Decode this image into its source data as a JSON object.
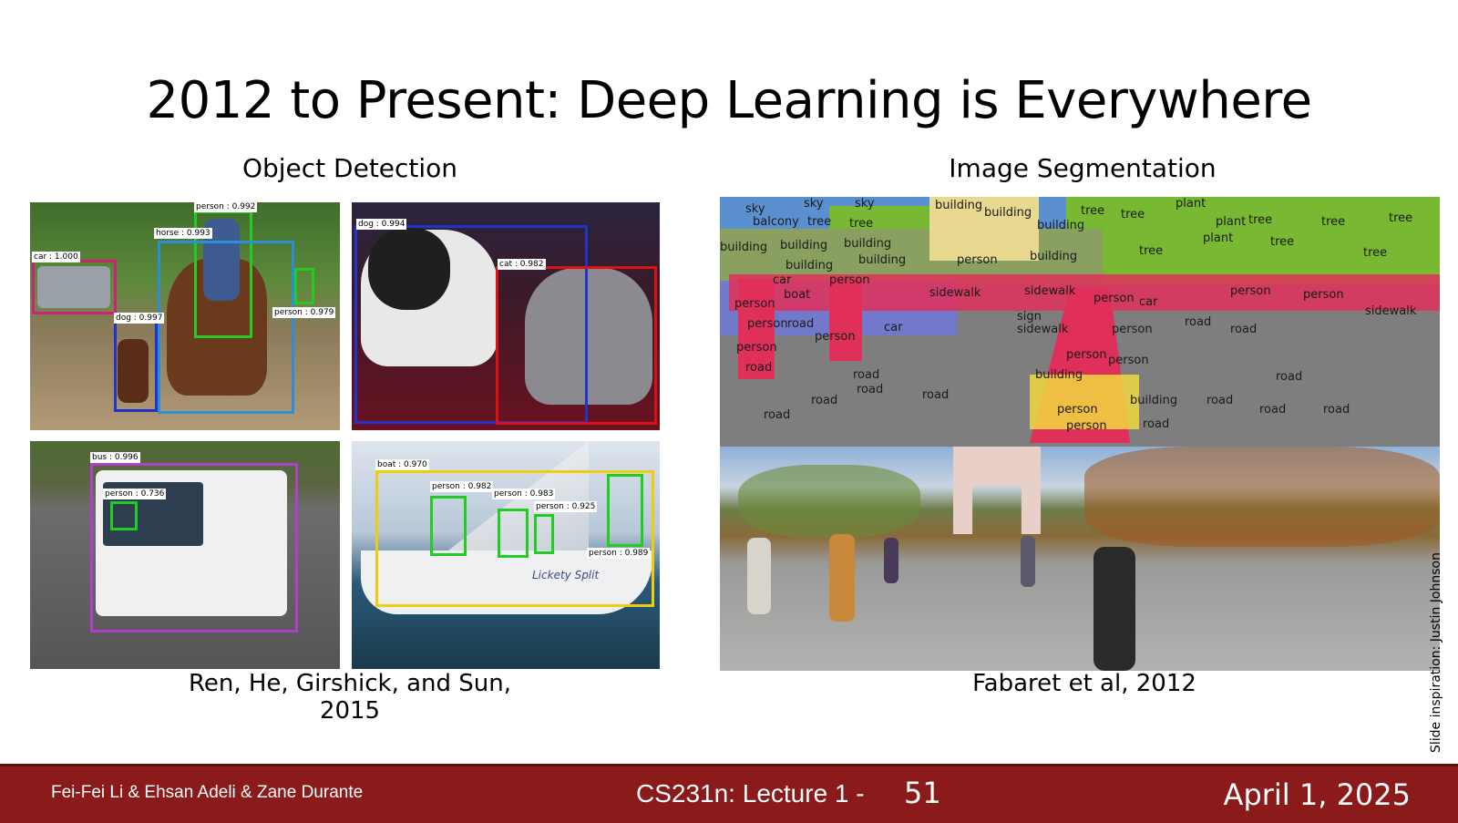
{
  "slide": {
    "title": "2012 to Present: Deep Learning is Everywhere",
    "left_heading": "Object Detection",
    "right_heading": "Image Segmentation",
    "left_caption": "Ren, He, Girshick, and Sun, 2015",
    "right_caption": "Fabaret et al, 2012",
    "side_credit": "Slide inspiration: Justin Johnson"
  },
  "detections": {
    "panel1": [
      "person : 0.992",
      "car : 1.000",
      "horse : 0.993",
      "dog : 0.997",
      "person : 0.979"
    ],
    "panel2": [
      "dog : 0.994",
      "cat : 0.982"
    ],
    "panel3": [
      "bus : 0.996",
      "person : 0.736"
    ],
    "panel4": [
      "boat : 0.970",
      "person : 0.982",
      "person : 0.983",
      "person : 0.925",
      "person : 0.989"
    ],
    "boat_text": "Lickety Split"
  },
  "segmentation_labels": {
    "sky": "sky",
    "tree": "tree",
    "building": "building",
    "plant": "plant",
    "person": "person",
    "car": "car",
    "road": "road",
    "sidewalk": "sidewalk",
    "balcony": "balcony",
    "boat": "boat",
    "sign": "sign"
  },
  "footer": {
    "authors": "Fei-Fei Li & Ehsan Adeli & Zane Durante",
    "course": "CS231n: Lecture 1 -",
    "page": "51",
    "date": "April 1, 2025"
  },
  "colors": {
    "footer_bg": "#8b1a1a",
    "box_person": "#22cc22",
    "box_car": "#cc2277",
    "box_horse": "#2a8fd6",
    "box_dog": "#2233cc",
    "box_cat": "#dd1111",
    "box_bus": "#b040c8",
    "box_boat": "#f0cc10",
    "seg_tree": "#78b832",
    "seg_person": "#e0305a",
    "seg_building": "#e8d890",
    "seg_car": "#7078d8",
    "seg_road": "#7a7a7a"
  }
}
